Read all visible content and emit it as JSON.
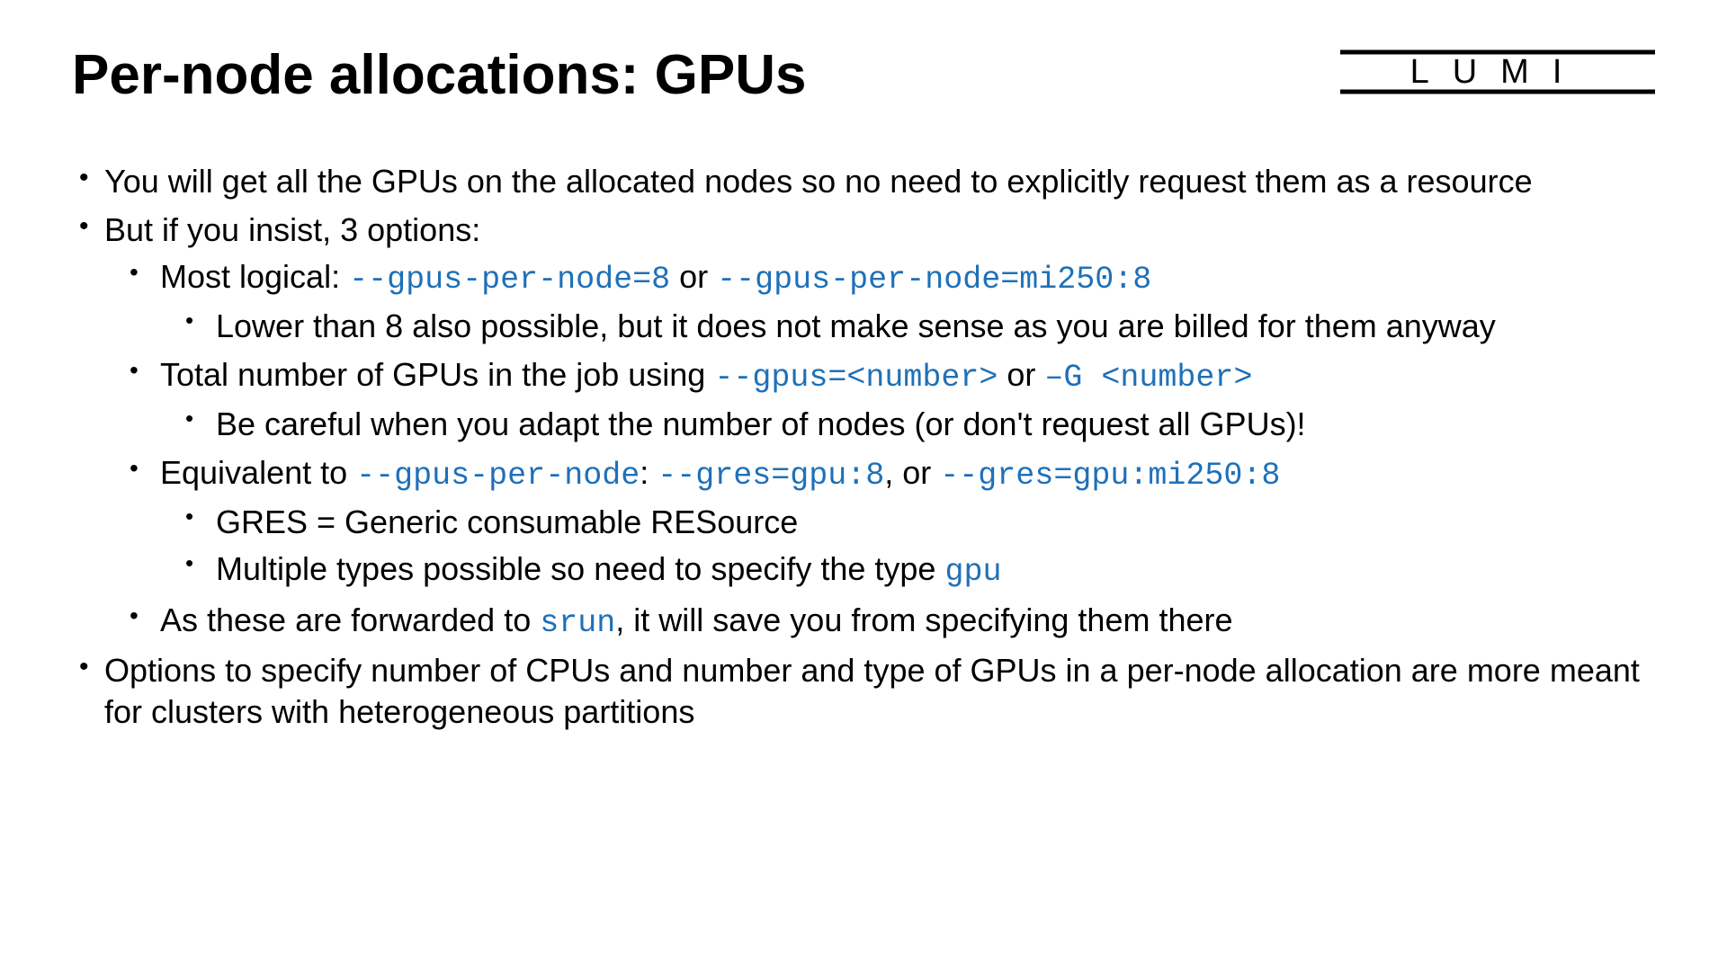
{
  "title": "Per-node allocations: GPUs",
  "logo": "LUMI",
  "bullets": {
    "b1": "You will get all the GPUs on the allocated nodes so no need to explicitly request them as a resource",
    "b2": "But if you insist, 3 options:",
    "b2_1_pre": "Most logical: ",
    "b2_1_code1": "--gpus-per-node=8",
    "b2_1_mid": " or ",
    "b2_1_code2": "--gpus-per-node=mi250:8",
    "b2_1_1": " Lower than 8 also possible, but it does not make sense as you are billed for them anyway",
    "b2_2_pre": "Total number of GPUs in the job using ",
    "b2_2_code1": "--gpus=<number>",
    "b2_2_mid": " or ",
    "b2_2_code2": "–G <number>",
    "b2_2_1": "Be careful when you adapt the number of nodes (or don't request all GPUs)!",
    "b2_3_pre": "Equivalent to ",
    "b2_3_code1": "--gpus-per-node",
    "b2_3_mid1": ": ",
    "b2_3_code2": "--gres=gpu:8",
    "b2_3_mid2": ", or ",
    "b2_3_code3": "--gres=gpu:mi250:8",
    "b2_3_1": "GRES = Generic consumable RESource",
    "b2_3_2_pre": "Multiple types possible so need to specify the type ",
    "b2_3_2_code": "gpu",
    "b2_4_pre": "As these are forwarded to ",
    "b2_4_code": "srun",
    "b2_4_post": ", it will save you from specifying them there",
    "b3": "Options to specify number of CPUs and number and type of GPUs in a per-node allocation are more meant for clusters with heterogeneous partitions"
  }
}
